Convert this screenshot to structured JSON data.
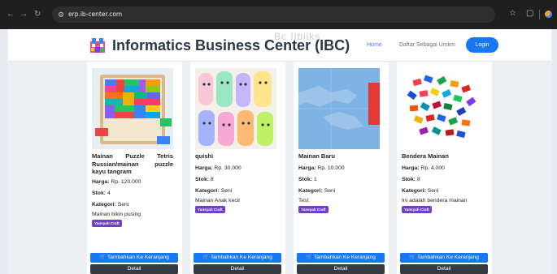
{
  "browser": {
    "url": "erp.ib-center.com"
  },
  "navbar": {
    "brand": "Informatics Business Center (IBC)",
    "ghost_text": "Bc Ilbiiks",
    "links": [
      "Home",
      "Daftar Sebagai Umkm"
    ],
    "login_label": "Login"
  },
  "labels": {
    "price": "Harga:",
    "stock": "Stok:",
    "category": "Kategori:",
    "add_to_cart": "Tambahkan Ke Keranjang",
    "detail": "Detail"
  },
  "products": [
    {
      "name": "Mainan Puzzle Tetris Russian/mainan puzzle kayu tangram",
      "price": "Rp. 120.000",
      "stock": "4",
      "category": "Seni",
      "description": "Mainan bikin pusing",
      "store": "Yansyah Craft"
    },
    {
      "name": "quishi",
      "price": "Rp. 30.000",
      "stock": "8",
      "category": "Seni",
      "description": "Mainan Anak kecil",
      "store": "Yansyah Craft"
    },
    {
      "name": "Mainan Baru",
      "price": "Rp. 10.000",
      "stock": "1",
      "category": "Seni",
      "description": "Test",
      "store": "Yansyah Craft"
    },
    {
      "name": "Bendera Mainan",
      "price": "Rp. 4.000",
      "stock": "8",
      "category": "Seni",
      "description": "Ini adalah bendera mainan",
      "store": "Yansyah Craft"
    }
  ],
  "colors": {
    "primary": "#1877f2",
    "dark": "#343a40",
    "badge": "#6f42c1",
    "brand_text": "#2d3648"
  },
  "icons": [
    "back-arrow-icon",
    "forward-arrow-icon",
    "reload-icon",
    "site-info-icon",
    "star-icon",
    "extension-icon",
    "cart-icon"
  ]
}
